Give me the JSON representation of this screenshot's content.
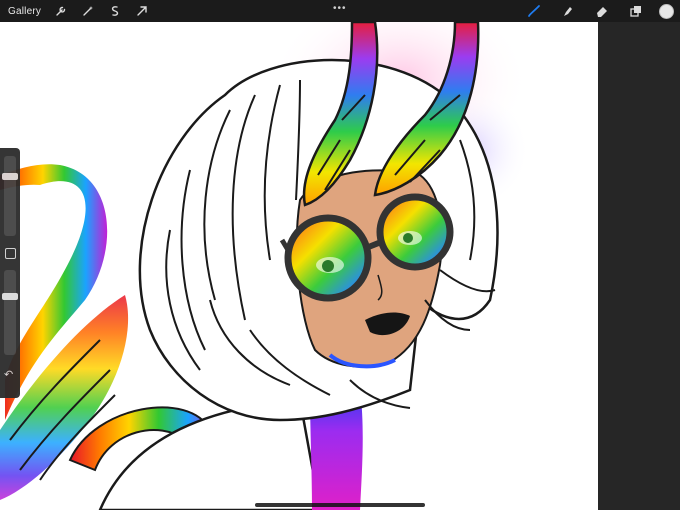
{
  "topbar": {
    "gallery_label": "Gallery",
    "left_tools": [
      "wrench-icon",
      "magic-wand-icon",
      "selection-icon",
      "transform-arrow-icon"
    ],
    "more_label": "•••",
    "right_tools": [
      "brush-icon",
      "smudge-icon",
      "eraser-icon",
      "layers-icon"
    ],
    "current_color": "#e7e7e7",
    "accent_color": "#1f7cf0"
  },
  "sidebar": {
    "size_slider_level": 0.25,
    "opacity_slider_level": 0.3,
    "undo_symbol": "↶"
  }
}
